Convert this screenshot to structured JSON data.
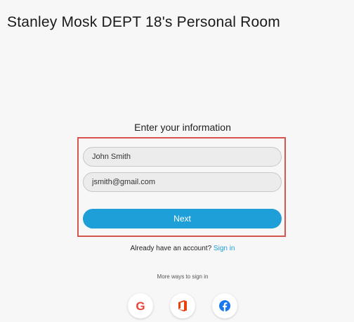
{
  "page": {
    "title": "Stanley Mosk DEPT 18's Personal Room"
  },
  "form": {
    "heading": "Enter your information",
    "name_value": "John Smith",
    "email_value": "jsmith@gmail.com",
    "next_label": "Next"
  },
  "account": {
    "prompt": "Already have an account?",
    "signin_label": "Sign in"
  },
  "more_ways": {
    "label": "More ways to sign in",
    "providers": [
      {
        "icon": "google-icon",
        "glyph": "G"
      },
      {
        "icon": "office-icon"
      },
      {
        "icon": "facebook-icon"
      }
    ]
  },
  "colors": {
    "accent": "#1f9fd8",
    "highlight": "#d9534f",
    "google_red": "#ea4335",
    "google_blue": "#4285f4",
    "google_yellow": "#fbbc05",
    "google_green": "#34a853",
    "office_orange": "#e8410c",
    "facebook_blue": "#1877f2"
  }
}
